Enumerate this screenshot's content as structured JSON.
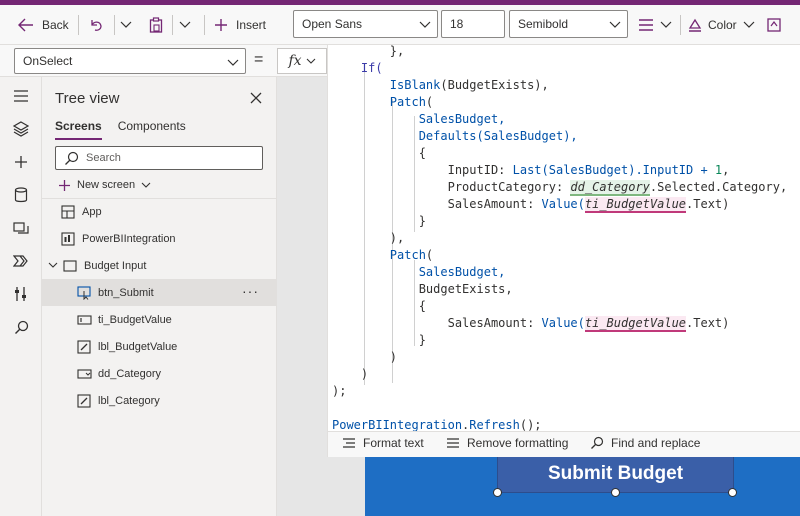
{
  "toolbar": {
    "back_label": "Back",
    "insert_label": "Insert",
    "font_family": "Open Sans",
    "font_size": "18",
    "font_weight": "Semibold",
    "color_label": "Color"
  },
  "formula_bar": {
    "property": "OnSelect",
    "equals": "=",
    "fx_label": "fx"
  },
  "tree": {
    "title": "Tree view",
    "tabs": [
      "Screens",
      "Components"
    ],
    "search_placeholder": "Search",
    "new_screen_label": "New screen",
    "nodes": [
      {
        "label": "App"
      },
      {
        "label": "PowerBIIntegration"
      },
      {
        "label": "Budget Input"
      },
      {
        "label": "btn_Submit"
      },
      {
        "label": "ti_BudgetValue"
      },
      {
        "label": "lbl_BudgetValue"
      },
      {
        "label": "dd_Category"
      },
      {
        "label": "lbl_Category"
      }
    ]
  },
  "code": {
    "lines": {
      "l0": "},",
      "l1": "If(",
      "l2a": "IsBlank",
      "l2b": "(BudgetExists),",
      "l3a": "Patch",
      "l3b": "(",
      "l4": "SalesBudget,",
      "l5a": "Defaults",
      "l5b": "(SalesBudget),",
      "l6": "{",
      "l7a": "InputID: ",
      "l7b": "Last",
      "l7c": "(SalesBudget).InputID + ",
      "l7d": "1",
      "l7e": ",",
      "l8a": "ProductCategory: ",
      "l8b": "dd_Category",
      "l8c": ".Selected.Category,",
      "l9a": "SalesAmount: ",
      "l9b": "Value",
      "l9c": "(",
      "l9d": "ti_BudgetValue",
      "l9e": ".Text)",
      "l10": "}",
      "l11": "),",
      "l12a": "Patch",
      "l12b": "(",
      "l13": "SalesBudget,",
      "l14": "BudgetExists,",
      "l15": "{",
      "l16a": "SalesAmount: ",
      "l16b": "Value",
      "l16c": "(",
      "l16d": "ti_BudgetValue",
      "l16e": ".Text)",
      "l17": "}",
      "l18": ")",
      "l19": ")",
      "l20": ");",
      "l21": "",
      "l22a": "PowerBIIntegration",
      "l22b": ".",
      "l22c": "Refresh",
      "l22d": "();"
    }
  },
  "editor_footer": {
    "format_text": "Format text",
    "remove_formatting": "Remove formatting",
    "find_replace": "Find and replace"
  },
  "canvas": {
    "submit_button_text": "Submit Budget"
  },
  "colors": {
    "accent": "#742774",
    "function_blue": "#0051a8",
    "canvas_button": "#3a5fa8"
  }
}
